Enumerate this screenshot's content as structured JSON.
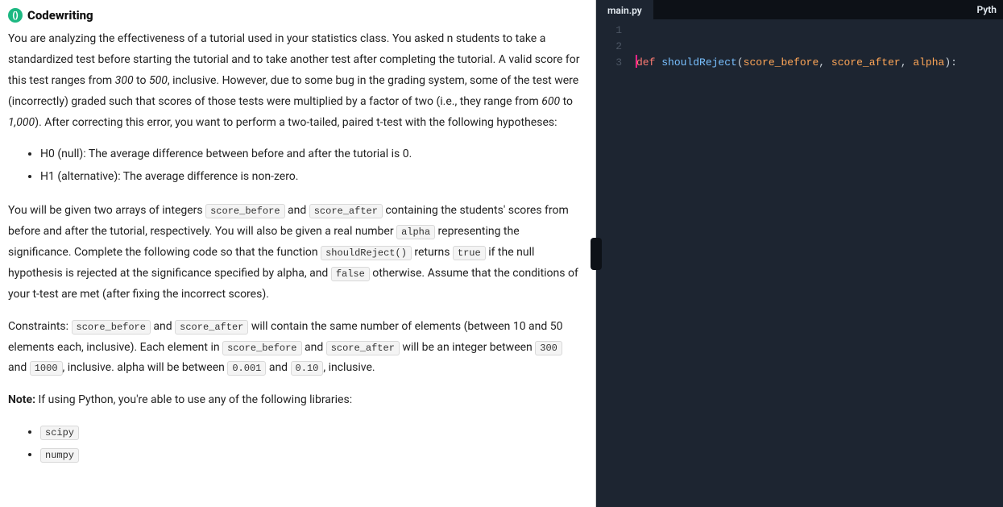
{
  "header": {
    "logo_glyph": "()",
    "title": "Codewriting"
  },
  "doc": {
    "p1_a": "You are analyzing the effectiveness of a tutorial used in your statistics class. You asked n students to take a standardized test before starting the tutorial and to take another test after completing the tutorial. A valid score for this test ranges from ",
    "p1_range1_low": "300",
    "p1_mid1": " to ",
    "p1_range1_high": "500",
    "p1_b": ", inclusive. However, due to some bug in the grading system, some of the test were (incorrectly) graded such that scores of those tests were multiplied by a factor of two (i.e., they range from ",
    "p1_range2_low": "600",
    "p1_mid2": " to ",
    "p1_range2_high": "1,000",
    "p1_c": "). After correcting this error, you want to perform a two-tailed, paired t-test with the following hypotheses:",
    "hyp": [
      "H0 (null): The average difference between before and after the tutorial is 0.",
      "H1 (alternative): The average difference is non-zero."
    ],
    "p2_a": "You will be given two arrays of integers ",
    "c_score_before": "score_before",
    "p2_b": " and ",
    "c_score_after": "score_after",
    "p2_c": " containing the students' scores from before and after the tutorial, respectively. You will also be given a real number ",
    "c_alpha": "alpha",
    "p2_d": " representing the significance. Complete the following code so that the function ",
    "c_fn": "shouldReject()",
    "p2_e": " returns ",
    "c_true": "true",
    "p2_f": " if the null hypothesis is rejected at the significance specified by alpha, and ",
    "c_false": "false",
    "p2_g": " otherwise. Assume that the conditions of your t-test are met (after fixing the incorrect scores).",
    "p3_a": "Constraints: ",
    "p3_b": " and ",
    "p3_c": " will contain the same number of elements (between 10 and 50 elements each, inclusive). Each element in ",
    "p3_d": " and ",
    "p3_e": " will be an integer between ",
    "c_300": "300",
    "p3_f": " and ",
    "c_1000": "1000",
    "p3_g": ", inclusive. alpha will be between ",
    "c_0001": "0.001",
    "p3_h": " and ",
    "c_010": "0.10",
    "p3_i": ", inclusive.",
    "note_label": "Note:",
    "note_text": " If using Python, you're able to use any of the following libraries:",
    "libs": [
      "scipy",
      "numpy"
    ]
  },
  "editor": {
    "tab": "main.py",
    "language": "Pyth",
    "line_numbers": [
      "1",
      "2",
      "3"
    ],
    "code": {
      "kw_def": "def",
      "sp1": " ",
      "fn": "shouldReject",
      "lp": "(",
      "arg1": "score_before",
      "c1": ", ",
      "arg2": "score_after",
      "c2": ", ",
      "arg3": "alpha",
      "rp": "):"
    }
  }
}
